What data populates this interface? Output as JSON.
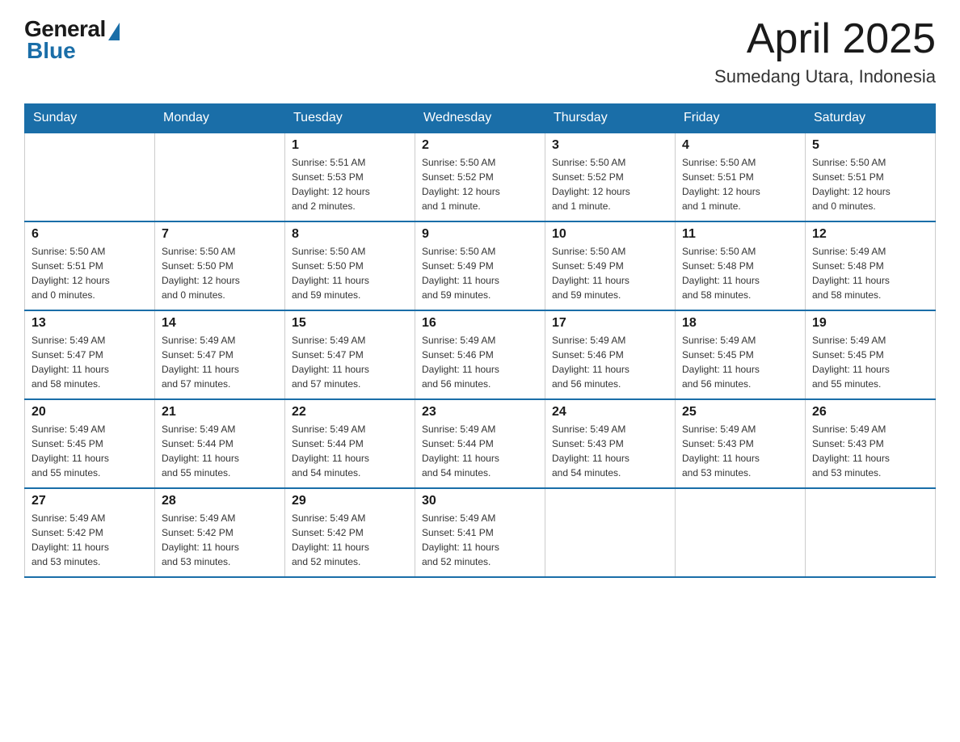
{
  "logo": {
    "general": "General",
    "blue": "Blue"
  },
  "title": "April 2025",
  "location": "Sumedang Utara, Indonesia",
  "days_of_week": [
    "Sunday",
    "Monday",
    "Tuesday",
    "Wednesday",
    "Thursday",
    "Friday",
    "Saturday"
  ],
  "weeks": [
    [
      {
        "day": "",
        "info": ""
      },
      {
        "day": "",
        "info": ""
      },
      {
        "day": "1",
        "info": "Sunrise: 5:51 AM\nSunset: 5:53 PM\nDaylight: 12 hours\nand 2 minutes."
      },
      {
        "day": "2",
        "info": "Sunrise: 5:50 AM\nSunset: 5:52 PM\nDaylight: 12 hours\nand 1 minute."
      },
      {
        "day": "3",
        "info": "Sunrise: 5:50 AM\nSunset: 5:52 PM\nDaylight: 12 hours\nand 1 minute."
      },
      {
        "day": "4",
        "info": "Sunrise: 5:50 AM\nSunset: 5:51 PM\nDaylight: 12 hours\nand 1 minute."
      },
      {
        "day": "5",
        "info": "Sunrise: 5:50 AM\nSunset: 5:51 PM\nDaylight: 12 hours\nand 0 minutes."
      }
    ],
    [
      {
        "day": "6",
        "info": "Sunrise: 5:50 AM\nSunset: 5:51 PM\nDaylight: 12 hours\nand 0 minutes."
      },
      {
        "day": "7",
        "info": "Sunrise: 5:50 AM\nSunset: 5:50 PM\nDaylight: 12 hours\nand 0 minutes."
      },
      {
        "day": "8",
        "info": "Sunrise: 5:50 AM\nSunset: 5:50 PM\nDaylight: 11 hours\nand 59 minutes."
      },
      {
        "day": "9",
        "info": "Sunrise: 5:50 AM\nSunset: 5:49 PM\nDaylight: 11 hours\nand 59 minutes."
      },
      {
        "day": "10",
        "info": "Sunrise: 5:50 AM\nSunset: 5:49 PM\nDaylight: 11 hours\nand 59 minutes."
      },
      {
        "day": "11",
        "info": "Sunrise: 5:50 AM\nSunset: 5:48 PM\nDaylight: 11 hours\nand 58 minutes."
      },
      {
        "day": "12",
        "info": "Sunrise: 5:49 AM\nSunset: 5:48 PM\nDaylight: 11 hours\nand 58 minutes."
      }
    ],
    [
      {
        "day": "13",
        "info": "Sunrise: 5:49 AM\nSunset: 5:47 PM\nDaylight: 11 hours\nand 58 minutes."
      },
      {
        "day": "14",
        "info": "Sunrise: 5:49 AM\nSunset: 5:47 PM\nDaylight: 11 hours\nand 57 minutes."
      },
      {
        "day": "15",
        "info": "Sunrise: 5:49 AM\nSunset: 5:47 PM\nDaylight: 11 hours\nand 57 minutes."
      },
      {
        "day": "16",
        "info": "Sunrise: 5:49 AM\nSunset: 5:46 PM\nDaylight: 11 hours\nand 56 minutes."
      },
      {
        "day": "17",
        "info": "Sunrise: 5:49 AM\nSunset: 5:46 PM\nDaylight: 11 hours\nand 56 minutes."
      },
      {
        "day": "18",
        "info": "Sunrise: 5:49 AM\nSunset: 5:45 PM\nDaylight: 11 hours\nand 56 minutes."
      },
      {
        "day": "19",
        "info": "Sunrise: 5:49 AM\nSunset: 5:45 PM\nDaylight: 11 hours\nand 55 minutes."
      }
    ],
    [
      {
        "day": "20",
        "info": "Sunrise: 5:49 AM\nSunset: 5:45 PM\nDaylight: 11 hours\nand 55 minutes."
      },
      {
        "day": "21",
        "info": "Sunrise: 5:49 AM\nSunset: 5:44 PM\nDaylight: 11 hours\nand 55 minutes."
      },
      {
        "day": "22",
        "info": "Sunrise: 5:49 AM\nSunset: 5:44 PM\nDaylight: 11 hours\nand 54 minutes."
      },
      {
        "day": "23",
        "info": "Sunrise: 5:49 AM\nSunset: 5:44 PM\nDaylight: 11 hours\nand 54 minutes."
      },
      {
        "day": "24",
        "info": "Sunrise: 5:49 AM\nSunset: 5:43 PM\nDaylight: 11 hours\nand 54 minutes."
      },
      {
        "day": "25",
        "info": "Sunrise: 5:49 AM\nSunset: 5:43 PM\nDaylight: 11 hours\nand 53 minutes."
      },
      {
        "day": "26",
        "info": "Sunrise: 5:49 AM\nSunset: 5:43 PM\nDaylight: 11 hours\nand 53 minutes."
      }
    ],
    [
      {
        "day": "27",
        "info": "Sunrise: 5:49 AM\nSunset: 5:42 PM\nDaylight: 11 hours\nand 53 minutes."
      },
      {
        "day": "28",
        "info": "Sunrise: 5:49 AM\nSunset: 5:42 PM\nDaylight: 11 hours\nand 53 minutes."
      },
      {
        "day": "29",
        "info": "Sunrise: 5:49 AM\nSunset: 5:42 PM\nDaylight: 11 hours\nand 52 minutes."
      },
      {
        "day": "30",
        "info": "Sunrise: 5:49 AM\nSunset: 5:41 PM\nDaylight: 11 hours\nand 52 minutes."
      },
      {
        "day": "",
        "info": ""
      },
      {
        "day": "",
        "info": ""
      },
      {
        "day": "",
        "info": ""
      }
    ]
  ]
}
